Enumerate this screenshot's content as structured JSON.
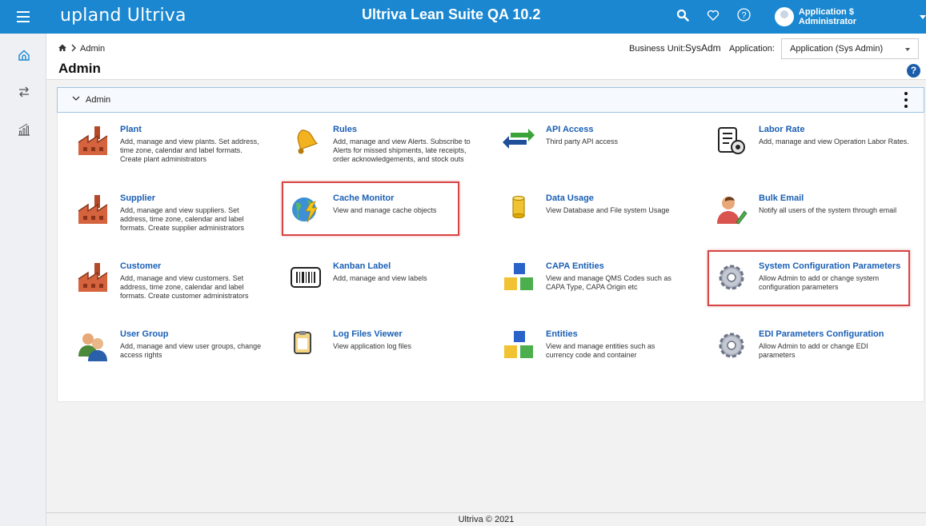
{
  "topbar": {
    "logo": "upland Ultriva",
    "title": "Ultriva Lean Suite QA 10.2",
    "user": "Application $ Administrator",
    "icons": [
      "search-icon",
      "heart-icon",
      "help-circle-icon",
      "avatar-icon"
    ]
  },
  "sidebar": {
    "icons": [
      "home-icon",
      "swap-icon",
      "analytics-icon"
    ]
  },
  "header": {
    "breadcrumb": "Admin",
    "page_title": "Admin",
    "business_unit_label": "Business Unit:",
    "business_unit_value": "SysAdm",
    "application_label": "Application:",
    "application_value": "Application (Sys Admin)",
    "help": "?"
  },
  "panel": {
    "title": "Admin"
  },
  "tiles": [
    {
      "name": "Plant",
      "desc": "Add, manage and view plants. Set address, time zone, calendar and label formats. Create plant administrators",
      "icon": "factory-icon"
    },
    {
      "name": "Rules",
      "desc": "Add, manage and view Alerts. Subscribe to Alerts for missed shipments, late receipts, order acknowledgements, and stock outs",
      "icon": "bell-icon"
    },
    {
      "name": "API Access",
      "desc": "Third party API access",
      "icon": "arrows-icon"
    },
    {
      "name": "Labor Rate",
      "desc": "Add, manage and view Operation Labor Rates.",
      "icon": "document-gear-icon"
    },
    {
      "name": "Supplier",
      "desc": "Add, manage and view suppliers. Set address, time zone, calendar and label formats. Create supplier administrators",
      "icon": "factory-icon"
    },
    {
      "name": "Cache Monitor",
      "desc": "View and manage cache objects",
      "icon": "globe-lightning-icon"
    },
    {
      "name": "Data Usage",
      "desc": "View Database and File system Usage",
      "icon": "database-icon"
    },
    {
      "name": "Bulk Email",
      "desc": "Notify all users of the system through email",
      "icon": "user-pencil-icon"
    },
    {
      "name": "Customer",
      "desc": "Add, manage and view customers. Set address, time zone, calendar and label formats. Create customer administrators",
      "icon": "factory-icon"
    },
    {
      "name": "Kanban Label",
      "desc": "Add, manage and view labels",
      "icon": "barcode-icon"
    },
    {
      "name": "CAPA Entities",
      "desc": "View and manage QMS Codes such as CAPA Type, CAPA Origin etc",
      "icon": "cubes-icon"
    },
    {
      "name": "System Configuration Parameters",
      "desc": "Allow Admin to add or change system configuration parameters",
      "icon": "gear-icon"
    },
    {
      "name": "User Group",
      "desc": "Add, manage and view user groups, change access rights",
      "icon": "users-icon"
    },
    {
      "name": "Log Files Viewer",
      "desc": "View application log files",
      "icon": "clipboard-icon"
    },
    {
      "name": "Entities",
      "desc": "View and manage entities such as currency code and container",
      "icon": "cubes-icon"
    },
    {
      "name": "EDI Parameters Configuration",
      "desc": "Allow Admin to add or change EDI parameters",
      "icon": "gear-icon"
    }
  ],
  "footer": {
    "text": "Ultriva © 2021"
  },
  "colors": {
    "topbar": "#1a87d0",
    "link": "#1a5fb4",
    "highlight": "#d64545"
  }
}
